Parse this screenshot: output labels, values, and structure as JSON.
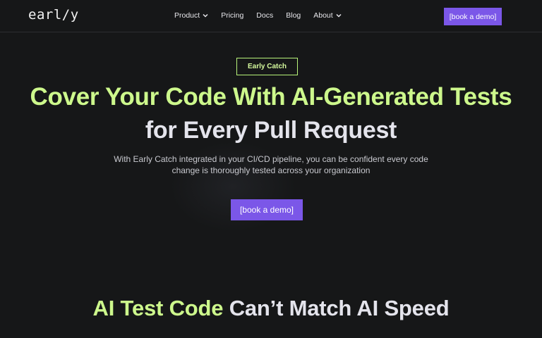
{
  "brand": {
    "logo_text": "earl/y"
  },
  "nav": {
    "items": [
      {
        "label": "Product",
        "has_dropdown": true
      },
      {
        "label": "Pricing",
        "has_dropdown": false
      },
      {
        "label": "Docs",
        "has_dropdown": false
      },
      {
        "label": "Blog",
        "has_dropdown": false
      },
      {
        "label": "About",
        "has_dropdown": true
      }
    ],
    "cta_label": "[book a demo]"
  },
  "hero": {
    "badge": "Early Catch",
    "headline_line1": "Cover Your Code With AI-Generated Tests",
    "headline_line2": "for Every Pull Request",
    "subtext": "With Early Catch integrated in your CI/CD pipeline, you can be confident every code change is thoroughly tested across your organization",
    "cta_label": "[book a demo]"
  },
  "section": {
    "title_accent": "AI Test Code",
    "title_rest": " Can’t Match AI Speed"
  },
  "colors": {
    "background": "#161718",
    "accent_green": "#cdf88c",
    "button_purple": "#7b57e8",
    "text_light": "#e4e4ec"
  },
  "icons": {
    "dropdown": "chevron-down-icon"
  }
}
